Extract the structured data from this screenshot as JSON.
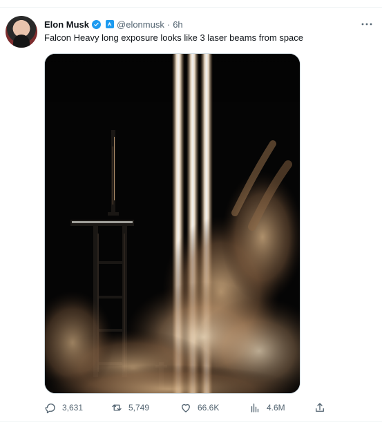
{
  "post": {
    "author_name": "Elon Musk",
    "author_handle": "@elonmusk",
    "separator": "·",
    "time": "6h",
    "text": "Falcon Heavy long exposure looks like 3 laser beams from space"
  },
  "actions": {
    "replies": "3,631",
    "reposts": "5,749",
    "likes": "66.6K",
    "views": "4.6M"
  },
  "icons": {
    "verified": "verified-badge-icon",
    "more": "more-icon",
    "reply": "reply-icon",
    "repost": "repost-icon",
    "like": "heart-icon",
    "views": "views-icon",
    "share": "share-icon"
  },
  "colors": {
    "accent": "#1d9bf0",
    "muted_text": "#536471",
    "primary_text": "#0f1419",
    "border": "#eff3f4"
  }
}
